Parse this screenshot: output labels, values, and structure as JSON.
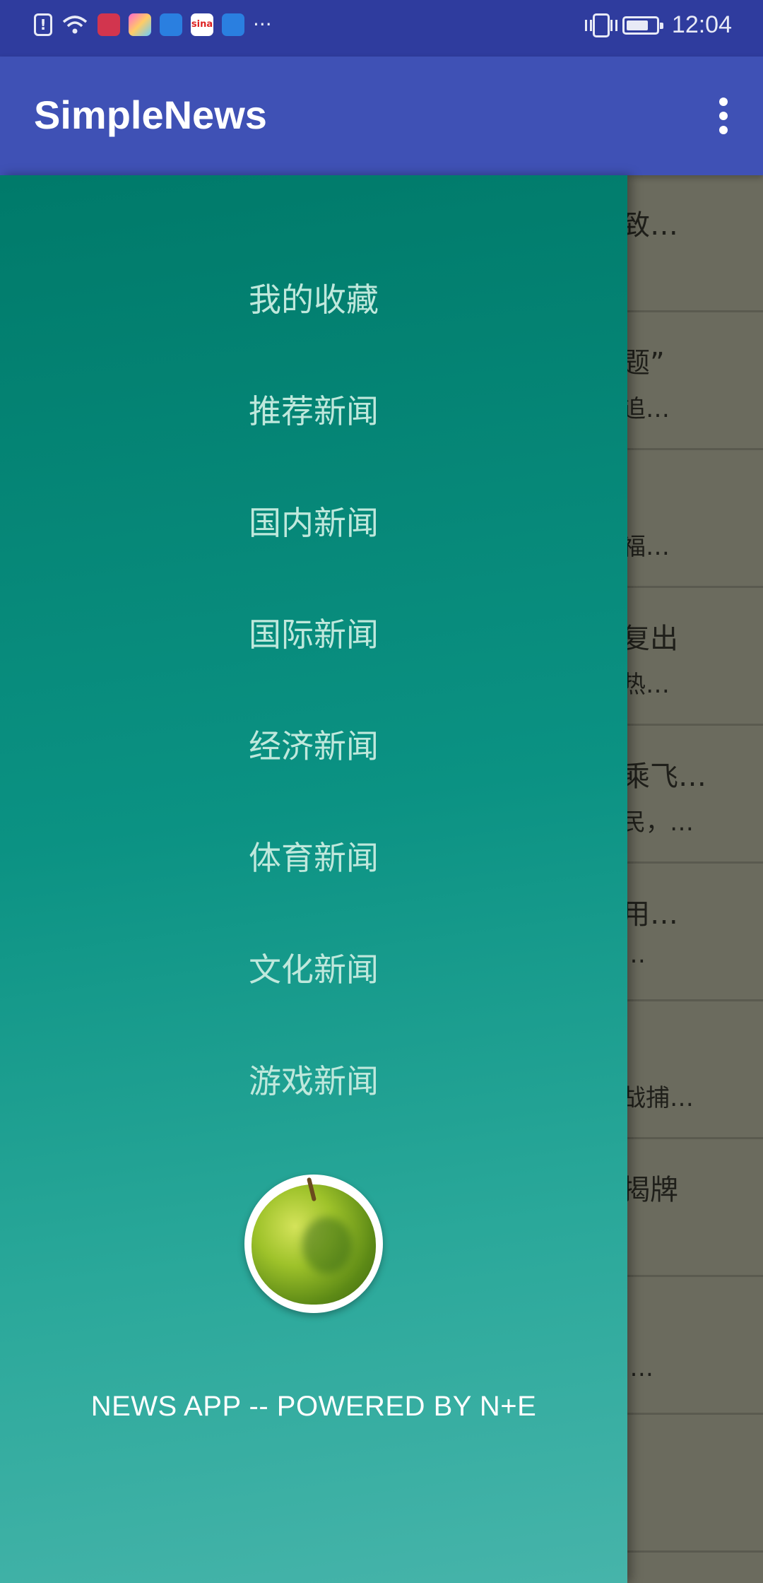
{
  "status_bar": {
    "time": "12:04",
    "dots": "···",
    "icons": [
      "alert-icon",
      "wifi-icon",
      "huawei-app-icon",
      "gallery-app-icon",
      "health-app-icon",
      "sina-app-icon",
      "health-app-icon-2"
    ],
    "sina_label": "sina",
    "battery_level": 0.75
  },
  "app_bar": {
    "title": "SimpleNews",
    "menu_icon": "overflow-menu-icon"
  },
  "drawer": {
    "items": [
      {
        "label": "我的收藏"
      },
      {
        "label": "推荐新闻"
      },
      {
        "label": "国内新闻"
      },
      {
        "label": "国际新闻"
      },
      {
        "label": "经济新闻"
      },
      {
        "label": "体育新闻"
      },
      {
        "label": "文化新闻"
      },
      {
        "label": "游戏新闻"
      }
    ],
    "avatar_icon": "green-apple-image",
    "footer": "NEWS APP -- POWERED BY N+E"
  },
  "background_list": [
    {
      "line1": "致…",
      "line2": ""
    },
    {
      "line1": "题”",
      "line2": "追…"
    },
    {
      "line1": "",
      "line2": "福…"
    },
    {
      "line1": "复出",
      "line2": "热…"
    },
    {
      "line1": "乘飞…",
      "line2": "民，…"
    },
    {
      "line1": "用…",
      "line2": "…"
    },
    {
      "line1": "",
      "line2": "战捕…"
    },
    {
      "line1": "揭牌",
      "line2": ""
    },
    {
      "line1": "",
      "line2": "…."
    },
    {
      "line1": "",
      "line2": ""
    }
  ],
  "colors": {
    "status_bar": "#2f3c9e",
    "app_bar": "#3f51b5",
    "drawer_top": "#007a6a",
    "drawer_bottom": "#46b4aa",
    "menu_text": "#bfe8dc"
  }
}
